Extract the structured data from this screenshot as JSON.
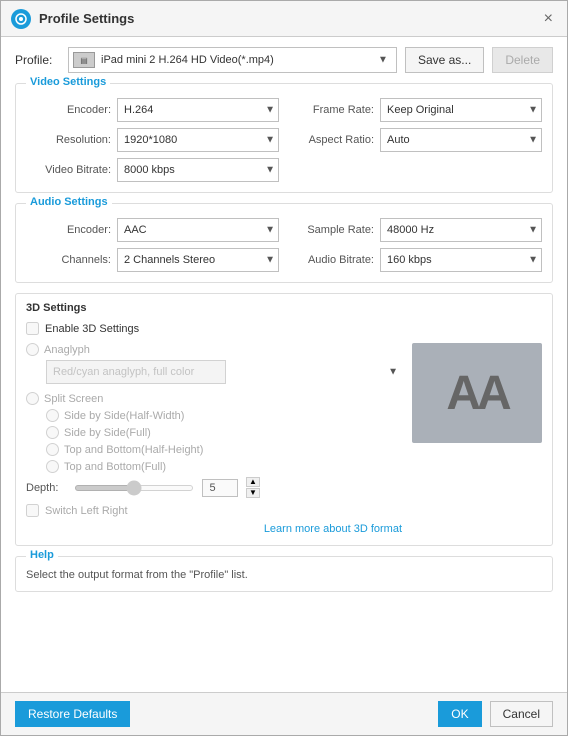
{
  "titleBar": {
    "title": "Profile Settings",
    "closeLabel": "×"
  },
  "profileRow": {
    "label": "Profile:",
    "selectedProfile": "iPad mini 2 H.264 HD Video(*.mp4)",
    "saveAsLabel": "Save as...",
    "deleteLabel": "Delete"
  },
  "videoSettings": {
    "sectionTitle": "Video Settings",
    "encoderLabel": "Encoder:",
    "encoderValue": "H.264",
    "resolutionLabel": "Resolution:",
    "resolutionValue": "1920*1080",
    "videoBitrateLabel": "Video Bitrate:",
    "videoBitrateValue": "8000 kbps",
    "frameRateLabel": "Frame Rate:",
    "frameRateValue": "Keep Original",
    "aspectRatioLabel": "Aspect Ratio:",
    "aspectRatioValue": "Auto"
  },
  "audioSettings": {
    "sectionTitle": "Audio Settings",
    "encoderLabel": "Encoder:",
    "encoderValue": "AAC",
    "channelsLabel": "Channels:",
    "channelsValue": "2 Channels Stereo",
    "sampleRateLabel": "Sample Rate:",
    "sampleRateValue": "48000 Hz",
    "audioBitrateLabel": "Audio Bitrate:",
    "audioBitrateValue": "160 kbps"
  },
  "threeDSettings": {
    "sectionTitle": "3D Settings",
    "enableCheckboxLabel": "Enable 3D Settings",
    "anaglyphLabel": "Anaglyph",
    "anaglyphOption": "Red/cyan anaglyph, full color",
    "splitScreenLabel": "Split Screen",
    "splitOptions": [
      "Side by Side(Half-Width)",
      "Side by Side(Full)",
      "Top and Bottom(Half-Height)",
      "Top and Bottom(Full)"
    ],
    "depthLabel": "Depth:",
    "depthValue": "5",
    "switchLeftRightLabel": "Switch Left Right",
    "learnMoreLabel": "Learn more about 3D format",
    "aaPreviewText": "AA"
  },
  "help": {
    "sectionTitle": "Help",
    "helpText": "Select the output format from the \"Profile\" list."
  },
  "footer": {
    "restoreDefaultsLabel": "Restore Defaults",
    "okLabel": "OK",
    "cancelLabel": "Cancel"
  }
}
